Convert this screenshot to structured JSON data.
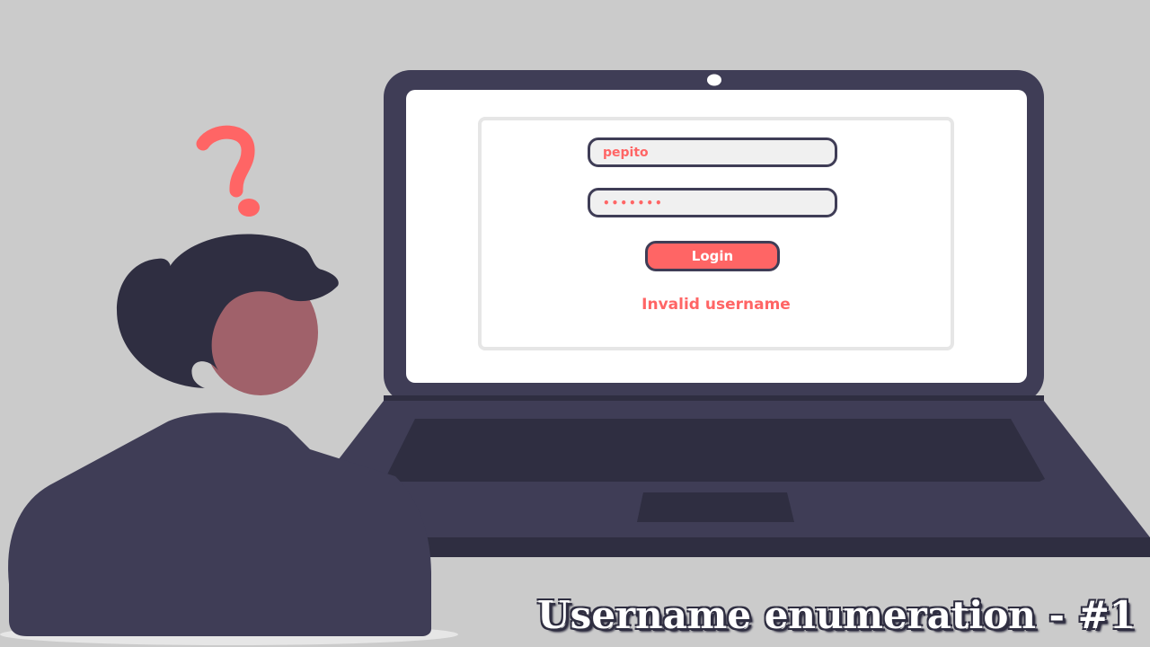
{
  "login_form": {
    "username_value": "pepito",
    "password_value": "1234567",
    "login_label": "Login",
    "error_message": "Invalid username"
  },
  "caption": "Username enumeration - #1",
  "colors": {
    "background": "#cbcbcb",
    "laptop": "#3f3d56",
    "laptop_dark": "#2f2e41",
    "accent": "#ff6565",
    "skin": "#a0616a",
    "hair": "#2f2e41",
    "screen": "#ffffff"
  }
}
